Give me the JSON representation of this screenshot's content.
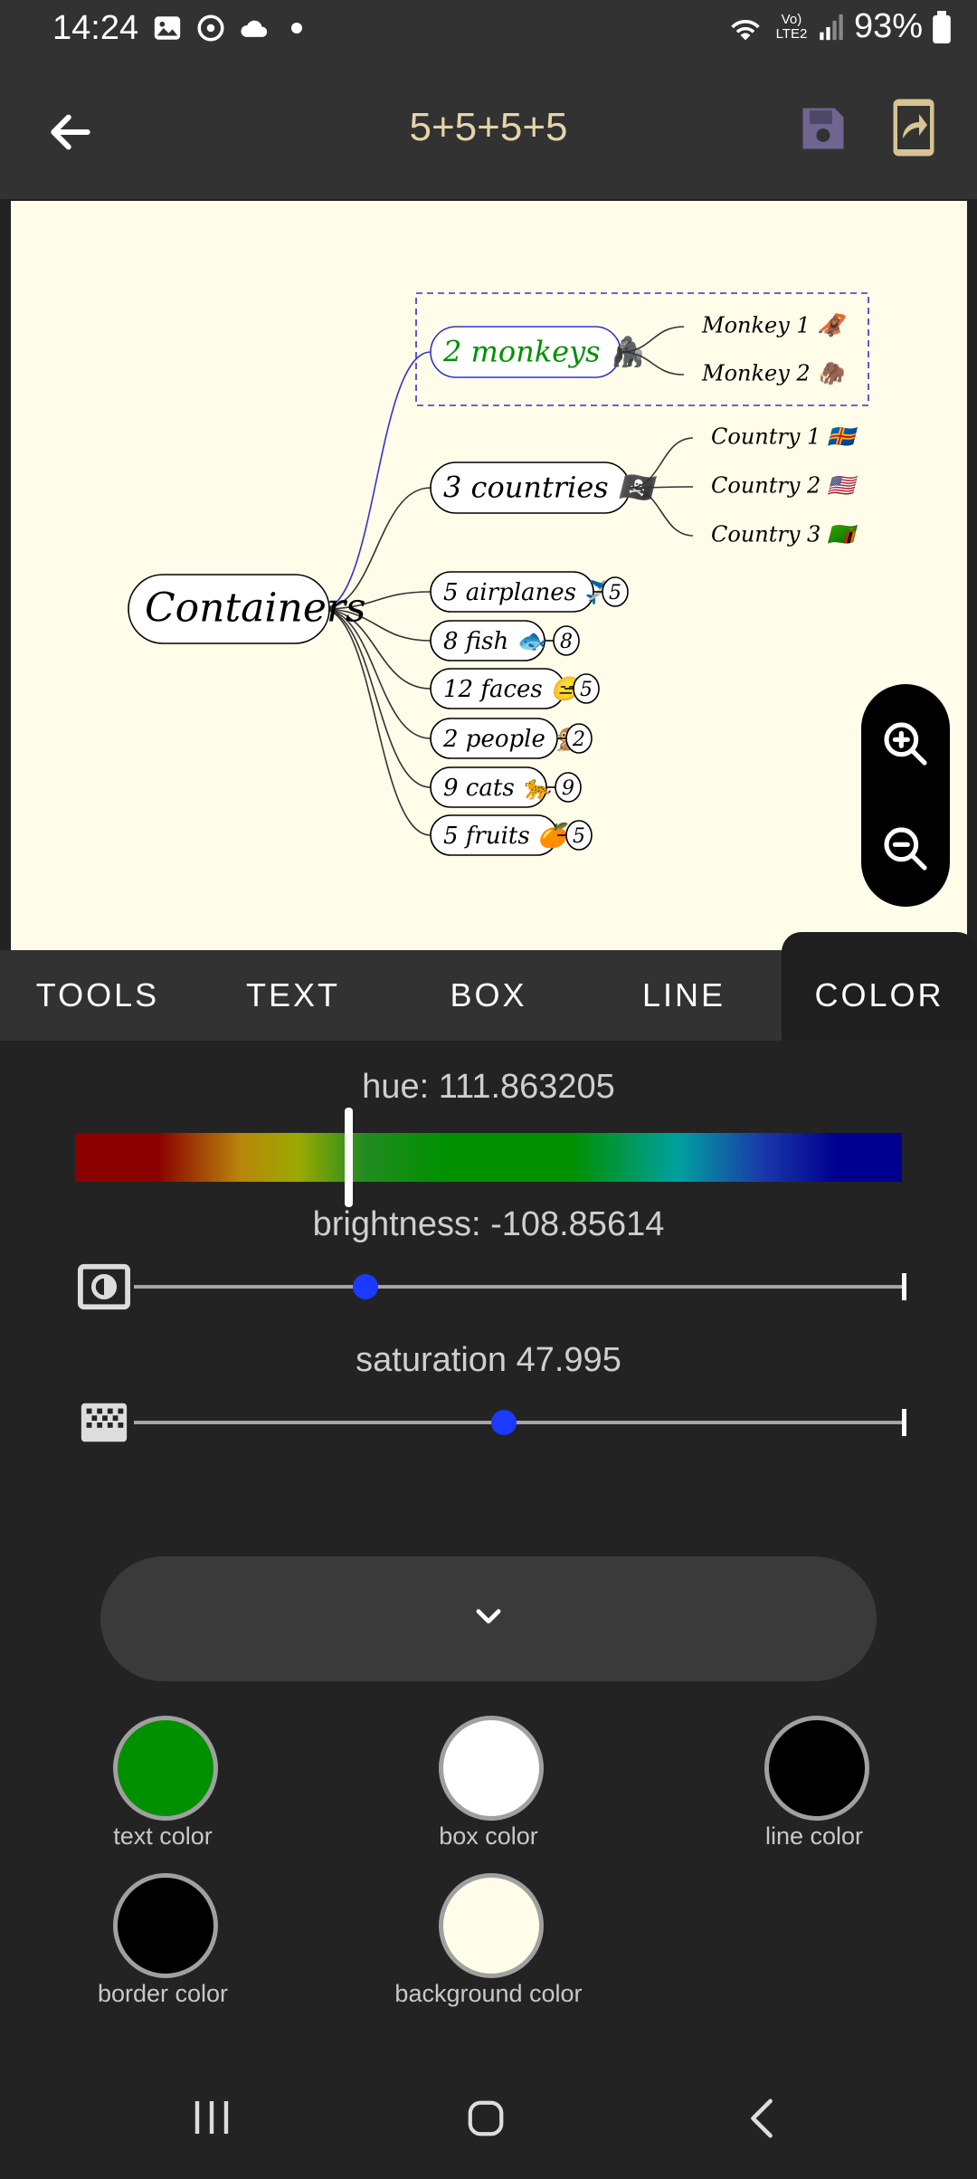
{
  "status": {
    "time": "14:24",
    "battery": "93%",
    "network": "Vo) LTE2",
    "icons": [
      "gallery-icon",
      "sync-icon",
      "cloud-icon",
      "notification-dot",
      "wifi-icon",
      "signal-icon",
      "battery-icon"
    ]
  },
  "header": {
    "title": "5+5+5+5",
    "icons": [
      "back-arrow-icon",
      "save-icon",
      "share-icon"
    ]
  },
  "mindmap": {
    "root": "Containers",
    "nodes": [
      {
        "label": "2 monkeys",
        "emoji": "🦍",
        "selected": true,
        "color": "#009000",
        "children": [
          {
            "label": "Monkey 1",
            "emoji": "🦧"
          },
          {
            "label": "Monkey 2",
            "emoji": "🦣"
          }
        ]
      },
      {
        "label": "3 countries",
        "emoji": "🏴‍☠️",
        "children": [
          {
            "label": "Country 1",
            "emoji": "🇦🇽"
          },
          {
            "label": "Country 2",
            "emoji": "🇺🇸"
          },
          {
            "label": "Country 3",
            "emoji": "🇿🇲"
          }
        ]
      },
      {
        "label": "5 airplanes",
        "emoji": "✈️",
        "count": "5"
      },
      {
        "label": "8 fish",
        "emoji": "🐟",
        "count": "8"
      },
      {
        "label": "12 faces",
        "emoji": "😑",
        "count": "5"
      },
      {
        "label": "2 people",
        "emoji": "🐒",
        "count": "2"
      },
      {
        "label": "9 cats",
        "emoji": "🐆",
        "count": "9"
      },
      {
        "label": "5 fruits",
        "emoji": "🍊",
        "count": "5"
      }
    ]
  },
  "zoom": {
    "icons": [
      "zoom-in-icon",
      "zoom-out-icon"
    ]
  },
  "tabs": [
    {
      "label": "TOOLS",
      "active": false
    },
    {
      "label": "TEXT",
      "active": false
    },
    {
      "label": "BOX",
      "active": false
    },
    {
      "label": "LINE",
      "active": false
    },
    {
      "label": "COLOR",
      "active": true
    }
  ],
  "color_panel": {
    "hue_label": "hue: 111.863205",
    "hue_value": 111.863205,
    "brightness_label": "brightness: -108.85614",
    "brightness_fraction": 0.3,
    "saturation_label": "saturation 47.995",
    "saturation_fraction": 0.47995,
    "icons": [
      "brightness-icon",
      "saturation-icon",
      "chevron-down-icon"
    ]
  },
  "swatches": [
    {
      "label": "text color",
      "color": "#009000"
    },
    {
      "label": "box color",
      "color": "#ffffff"
    },
    {
      "label": "line color",
      "color": "#000000"
    },
    {
      "label": "border color",
      "color": "#000000"
    },
    {
      "label": "background color",
      "color": "#fffde9"
    }
  ],
  "navbar": {
    "icons": [
      "recent-apps-icon",
      "home-icon",
      "back-icon"
    ]
  }
}
